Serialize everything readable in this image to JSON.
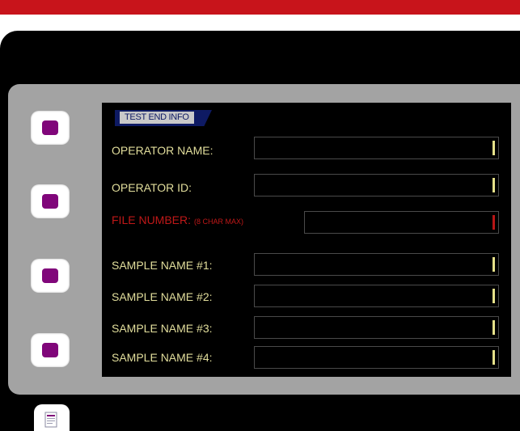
{
  "form": {
    "section_title": "TEST END INFO",
    "fields": [
      {
        "label": "OPERATOR NAME:",
        "sublabel": "",
        "value": ""
      },
      {
        "label": "OPERATOR ID:",
        "sublabel": "",
        "value": ""
      },
      {
        "label": "FILE NUMBER:",
        "sublabel": "(8 CHAR MAX)",
        "value": ""
      },
      {
        "label": "SAMPLE NAME #1:",
        "sublabel": "",
        "value": ""
      },
      {
        "label": "SAMPLE NAME #2:",
        "sublabel": "",
        "value": ""
      },
      {
        "label": "SAMPLE NAME #3:",
        "sublabel": "",
        "value": ""
      },
      {
        "label": "SAMPLE NAME #4:",
        "sublabel": "",
        "value": ""
      }
    ]
  },
  "side_buttons": [
    {
      "icon": "square-icon"
    },
    {
      "icon": "square-icon"
    },
    {
      "icon": "square-icon"
    },
    {
      "icon": "square-icon"
    }
  ],
  "bottom_button": {
    "icon": "document-icon"
  },
  "colors": {
    "header_bar": "#c8141b",
    "panel": "#a3a3a3",
    "label_text": "#e2de9c",
    "warning_text": "#c01818",
    "button_dot": "#80067a",
    "tab_background": "#0e1a63"
  }
}
